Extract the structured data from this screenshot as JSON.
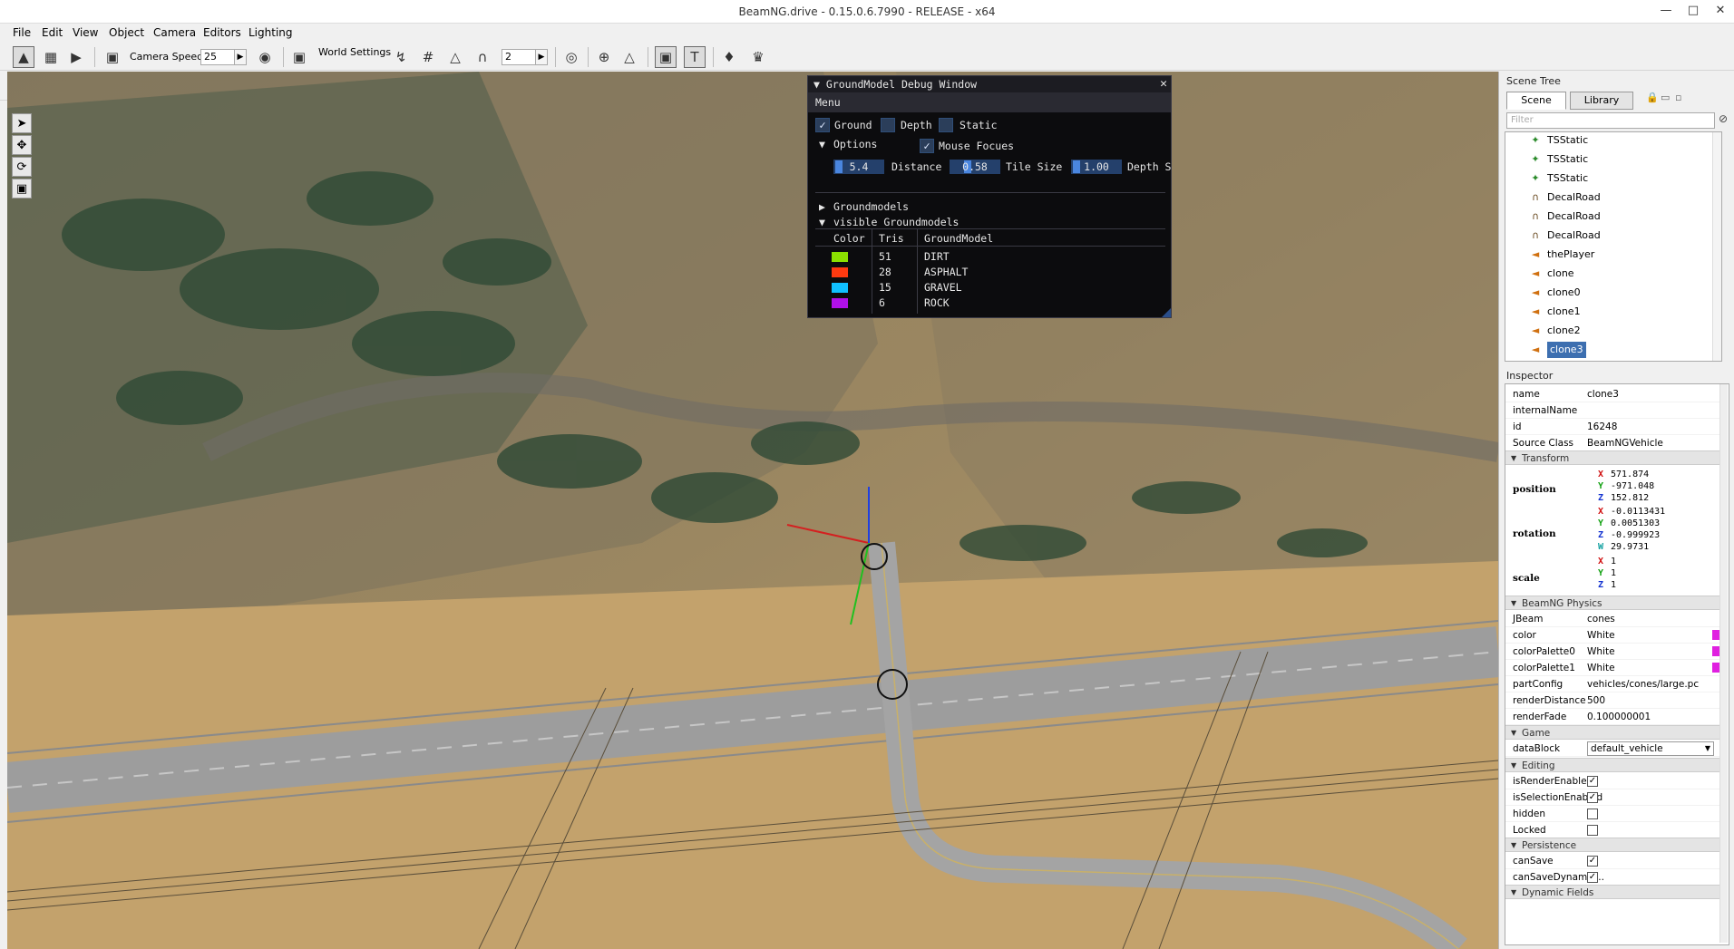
{
  "window": {
    "title": "BeamNG.drive - 0.15.0.6.7990 - RELEASE - x64"
  },
  "menu": [
    "File",
    "Edit",
    "View",
    "Object",
    "Camera",
    "Editors",
    "Lighting"
  ],
  "toolbar": {
    "camera_speed_label": "Camera Speed",
    "camera_speed_value": "25",
    "world_settings_label": "World Settings",
    "snap_value": "2"
  },
  "debug_window": {
    "title": "GroundModel Debug Window",
    "menu": "Menu",
    "checks": [
      {
        "label": "Ground",
        "checked": true
      },
      {
        "label": "Depth",
        "checked": false
      },
      {
        "label": "Static",
        "checked": false
      }
    ],
    "options_label": "Options",
    "mouse_focus": {
      "label": "Mouse Focues",
      "checked": true
    },
    "sliders": [
      {
        "value": "5.4",
        "label": "Distance"
      },
      {
        "value": "0.58",
        "label": "Tile Size"
      },
      {
        "value": "1.00",
        "label": "Depth S"
      }
    ],
    "groundmodels_label": "Groundmodels",
    "visible_label": "visible Groundmodels",
    "table_headers": [
      "Color",
      "Tris",
      "GroundModel"
    ],
    "table_rows": [
      {
        "color": "#8be000",
        "tris": "51",
        "name": "DIRT"
      },
      {
        "color": "#ff3a10",
        "tris": "28",
        "name": "ASPHALT"
      },
      {
        "color": "#10c0ff",
        "tris": "15",
        "name": "GRAVEL"
      },
      {
        "color": "#b010e8",
        "tris": "6",
        "name": "ROCK"
      }
    ]
  },
  "scene_tree": {
    "title": "Scene Tree",
    "tabs": [
      "Scene",
      "Library"
    ],
    "filter_placeholder": "Filter",
    "items": [
      {
        "label": "TSStatic",
        "icon": "tsstatic-icon"
      },
      {
        "label": "TSStatic",
        "icon": "tsstatic-icon"
      },
      {
        "label": "TSStatic",
        "icon": "tsstatic-icon"
      },
      {
        "label": "DecalRoad",
        "icon": "decalroad-icon"
      },
      {
        "label": "DecalRoad",
        "icon": "decalroad-icon"
      },
      {
        "label": "DecalRoad",
        "icon": "decalroad-icon"
      },
      {
        "label": "thePlayer",
        "icon": "vehicle-icon"
      },
      {
        "label": "clone",
        "icon": "vehicle-icon"
      },
      {
        "label": "clone0",
        "icon": "vehicle-icon"
      },
      {
        "label": "clone1",
        "icon": "vehicle-icon"
      },
      {
        "label": "clone2",
        "icon": "vehicle-icon"
      },
      {
        "label": "clone3",
        "icon": "vehicle-icon"
      }
    ]
  },
  "inspector": {
    "title": "Inspector",
    "basic": [
      {
        "k": "name",
        "v": "clone3"
      },
      {
        "k": "internalName",
        "v": ""
      },
      {
        "k": "id",
        "v": "16248"
      },
      {
        "k": "Source Class",
        "v": "BeamNGVehicle"
      }
    ],
    "transform_label": "Transform",
    "position_label": "position",
    "position": {
      "x": "571.874",
      "y": "-971.048",
      "z": "152.812"
    },
    "rotation_label": "rotation",
    "rotation": {
      "x": "-0.0113431",
      "y": "0.0051303",
      "z": "-0.999923",
      "w": "29.9731"
    },
    "scale_label": "scale",
    "scale": {
      "x": "1",
      "y": "1",
      "z": "1"
    },
    "physics_label": "BeamNG Physics",
    "physics": [
      {
        "k": "JBeam",
        "v": "cones"
      },
      {
        "k": "color",
        "v": "White"
      },
      {
        "k": "colorPalette0",
        "v": "White"
      },
      {
        "k": "colorPalette1",
        "v": "White"
      },
      {
        "k": "partConfig",
        "v": "vehicles/cones/large.pc"
      },
      {
        "k": "renderDistance",
        "v": "500"
      },
      {
        "k": "renderFade",
        "v": "0.100000001"
      }
    ],
    "game_label": "Game",
    "datablock_key": "dataBlock",
    "datablock_value": "default_vehicle",
    "editing_label": "Editing",
    "editing": [
      {
        "k": "isRenderEnabled",
        "checked": true
      },
      {
        "k": "isSelectionEnabled",
        "checked": true
      },
      {
        "k": "hidden",
        "checked": false
      },
      {
        "k": "Locked",
        "checked": false
      }
    ],
    "persistence_label": "Persistence",
    "persistence": [
      {
        "k": "canSave",
        "checked": true
      },
      {
        "k": "canSaveDynamic...",
        "checked": true
      }
    ],
    "dynamic_label": "Dynamic Fields"
  }
}
